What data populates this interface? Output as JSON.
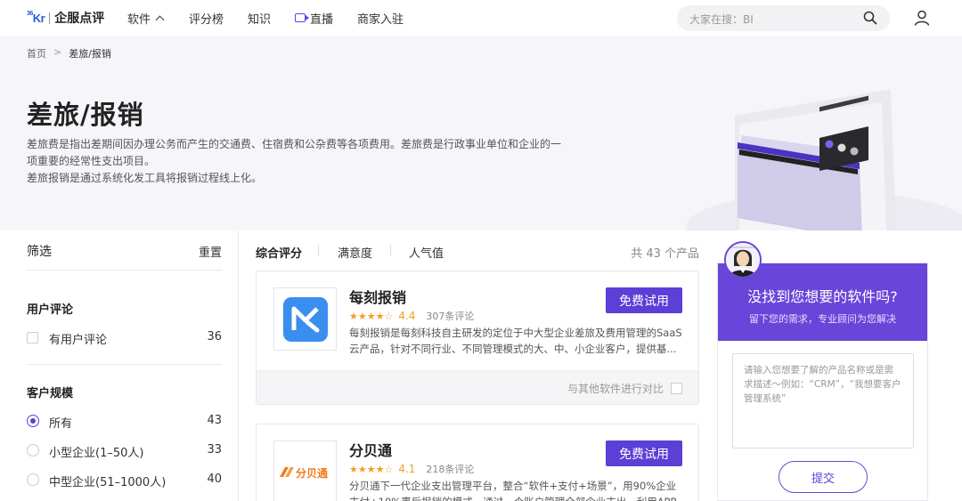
{
  "nav": {
    "logo_mark": "36Kr",
    "logo_text": "企服点评",
    "items": [
      "软件",
      "评分榜",
      "知识",
      "直播",
      "商家入驻"
    ],
    "search_placeholder": "大家在搜：BI"
  },
  "hero": {
    "breadcrumb": [
      "首页",
      ">",
      "差旅/报销"
    ],
    "title": "差旅/报销",
    "desc_lines": [
      "差旅费是指出差期间因办理公务而产生的交通费、住宿费和公杂费等各项费用。差旅费是行政事业单位和企业的一",
      "项重要的经常性支出项目。",
      "差旅报销是通过系统化发工具将报销过程线上化。"
    ]
  },
  "filter": {
    "title": "筛选",
    "reset": "重置",
    "groups": [
      {
        "title": "用户评论",
        "options": [
          {
            "label": "有用户评论",
            "count": "36",
            "type": "checkbox",
            "checked": false
          }
        ]
      },
      {
        "title": "客户规模",
        "options": [
          {
            "label": "所有",
            "count": "43",
            "type": "radio",
            "checked": true
          },
          {
            "label": "小型企业(1–50人)",
            "count": "33",
            "type": "radio",
            "checked": false
          },
          {
            "label": "中型企业(51–1000人)",
            "count": "40",
            "type": "radio",
            "checked": false
          }
        ]
      }
    ]
  },
  "list": {
    "sort_tabs": [
      "综合评分",
      "满意度",
      "人气值"
    ],
    "total": "共 43 个产品",
    "products": [
      {
        "name": "每刻报销",
        "stars": "★★★★☆",
        "score": "4.4",
        "reviews": "307条评论",
        "desc": "每刻报销是每刻科技自主研发的定位于中大型企业差旅及费用管理的SaaS云产品，针对不同行业、不同管理模式的大、中、小企业客户，提供基...",
        "trial": "免费试用",
        "compare": "与其他软件进行对比",
        "brand_color": "#3a8ef0"
      },
      {
        "name": "分贝通",
        "stars": "★★★★☆",
        "score": "4.1",
        "reviews": "218条评论",
        "desc": "分贝通下一代企业支出管理平台，整合“软件+支付+场景”，用90%企业支付+10%事后报销的模式，通过一个账户管理全部企业支出，利用APP...",
        "trial": "免费试用",
        "logo_text": "分贝通",
        "brand_color": "#f07a1a"
      }
    ]
  },
  "consult": {
    "title": "没找到您想要的软件吗?",
    "subtitle": "留下您的需求，专业顾问为您解决",
    "placeholder": "请输入您想要了解的产品名称或是需求描述～例如：“CRM”，“我想要客户管理系统”",
    "submit": "提交"
  },
  "colors": {
    "accent": "#5b3fd6",
    "consult_header": "#6a45d9",
    "star": "#f0a020"
  }
}
